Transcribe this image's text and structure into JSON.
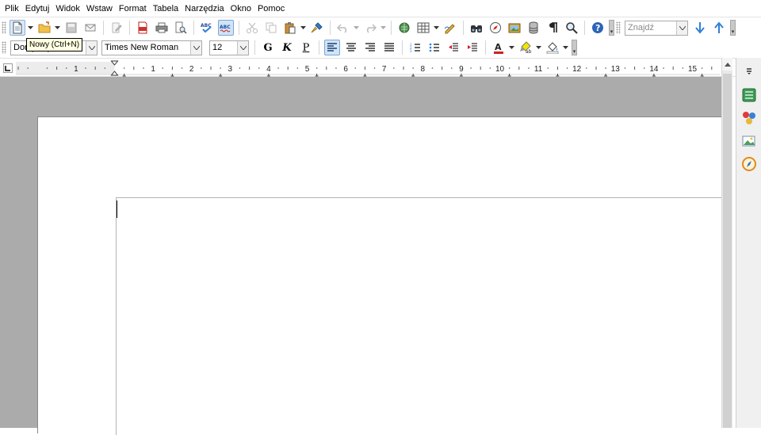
{
  "menubar": {
    "items": [
      {
        "label": "Plik",
        "name": "menu-plik"
      },
      {
        "label": "Edytuj",
        "name": "menu-edytuj"
      },
      {
        "label": "Widok",
        "name": "menu-widok"
      },
      {
        "label": "Wstaw",
        "name": "menu-wstaw"
      },
      {
        "label": "Format",
        "name": "menu-format"
      },
      {
        "label": "Tabela",
        "name": "menu-tabela"
      },
      {
        "label": "Narzędzia",
        "name": "menu-narzedzia"
      },
      {
        "label": "Okno",
        "name": "menu-okno"
      },
      {
        "label": "Pomoc",
        "name": "menu-pomoc"
      }
    ]
  },
  "standard_toolbar": {
    "find_placeholder": "Znajdź"
  },
  "tooltip": {
    "text": "Nowy (Ctrl+N)"
  },
  "formatting_toolbar": {
    "style_value": "Domyślny",
    "font_name": "Times New Roman",
    "font_size": "12",
    "bold_label": "G",
    "italic_label": "K",
    "underline_label": "P"
  },
  "ruler": {
    "numbers": [
      "1",
      "1",
      "2",
      "3",
      "4",
      "5",
      "6",
      "7",
      "8",
      "9",
      "10",
      "11",
      "12",
      "13",
      "14",
      "15"
    ]
  },
  "colors": {
    "accent": "#2f7ed8",
    "font_color": "#d02020",
    "highlight_color": "#f2e600",
    "doc_background": "#ababab"
  },
  "icons": {
    "new": "new-document-icon",
    "open": "open-folder-icon",
    "save": "save-icon",
    "email": "email-icon",
    "edit": "edit-document-icon",
    "pdf": "export-pdf-icon",
    "print": "print-icon",
    "preview": "print-preview-icon",
    "spell": "spellcheck-icon",
    "autospell": "autospellcheck-icon",
    "cut": "cut-icon",
    "copy": "copy-icon",
    "paste": "paste-icon",
    "clone": "clone-formatting-icon",
    "undo": "undo-icon",
    "redo": "redo-icon",
    "hyperlink": "hyperlink-icon",
    "table": "table-icon",
    "draw": "show-draw-functions-icon",
    "find": "find-replace-icon",
    "navigator": "navigator-icon",
    "gallery": "gallery-icon",
    "datasource": "data-sources-icon",
    "nonprint": "formatting-marks-icon",
    "zoom": "zoom-icon",
    "help": "help-icon"
  }
}
